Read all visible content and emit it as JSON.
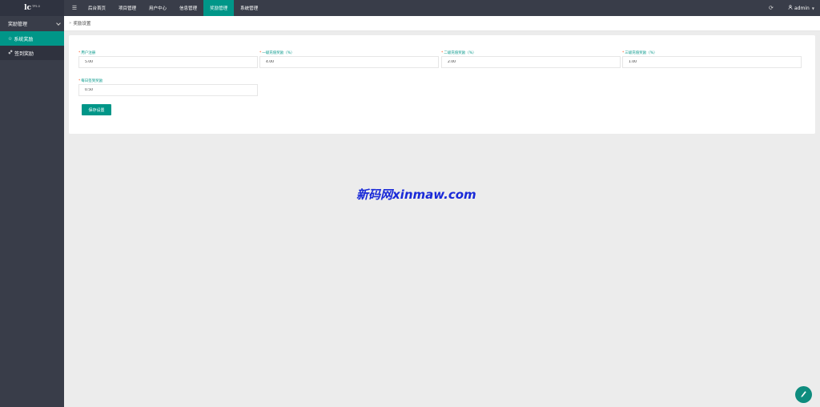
{
  "logo": {
    "main": "lc",
    "version": "TP5.0"
  },
  "sidebar": {
    "group_label": "奖励管理",
    "items": [
      {
        "label": "系统奖励",
        "icon": "star-icon",
        "active": true
      },
      {
        "label": "签到奖励",
        "icon": "link-icon",
        "active": false
      }
    ]
  },
  "topbar": {
    "menu_icon": "menu-icon",
    "nav": [
      {
        "label": "后台首页",
        "active": false
      },
      {
        "label": "项目管理",
        "active": false
      },
      {
        "label": "用户中心",
        "active": false
      },
      {
        "label": "信息管理",
        "active": false
      },
      {
        "label": "奖励管理",
        "active": true
      },
      {
        "label": "系统管理",
        "active": false
      }
    ],
    "refresh_icon": "refresh-icon",
    "user": {
      "name": "admin",
      "icon": "user-icon"
    }
  },
  "breadcrumb": {
    "sep": "»",
    "text": "奖励设置"
  },
  "form": {
    "fields": [
      {
        "label": "用户注册",
        "value": "5.00"
      },
      {
        "label": "一级充值奖励（%）",
        "value": "4.00"
      },
      {
        "label": "二级充值奖励（%）",
        "value": "2.00"
      },
      {
        "label": "三级充值奖励（%）",
        "value": "1.00"
      },
      {
        "label": "每日签到奖励",
        "value": "0.50"
      }
    ],
    "required_mark": "*",
    "save_label": "保存设置"
  },
  "watermark": "新码网xinmaw.com",
  "colors": {
    "accent": "#009688",
    "sidebar_bg": "#393d49",
    "page_bg": "#ececec",
    "watermark": "#1a2ad8"
  }
}
